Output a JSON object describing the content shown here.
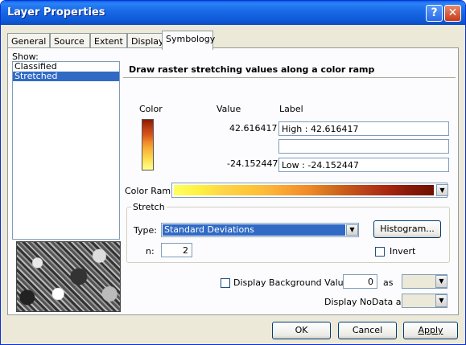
{
  "window": {
    "title": "Layer Properties",
    "help_label": "?",
    "close_label": "✕"
  },
  "tabs": [
    {
      "label": "General"
    },
    {
      "label": "Source"
    },
    {
      "label": "Extent"
    },
    {
      "label": "Display"
    },
    {
      "label": "Symbology",
      "active": true
    }
  ],
  "show": {
    "label": "Show:",
    "items": [
      {
        "label": "Classified",
        "selected": false
      },
      {
        "label": "Stretched",
        "selected": true
      }
    ]
  },
  "description": "Draw raster stretching values along a color ramp",
  "legend": {
    "col_color": "Color",
    "col_value": "Value",
    "col_label": "Label",
    "high_value": "42.616417",
    "low_value": "-24.152447",
    "high_label": "High : 42.616417",
    "middle_label": "",
    "low_label": "Low : -24.152447"
  },
  "color_ramp": {
    "label": "Color Ramp:"
  },
  "stretch": {
    "group_label": "Stretch",
    "type_label": "Type:",
    "type_value": "Standard Deviations",
    "n_label": "n:",
    "n_value": "2",
    "histogram_button": "Histogram...",
    "invert_label": "Invert",
    "invert_checked": false
  },
  "background": {
    "checkbox_label": "Display Background Value:",
    "checked": false,
    "value": "0",
    "as_label": "as"
  },
  "nodata": {
    "label": "Display NoData as"
  },
  "buttons": {
    "ok": "OK",
    "cancel": "Cancel",
    "apply": "Apply"
  },
  "dropdown_arrow": "▼"
}
